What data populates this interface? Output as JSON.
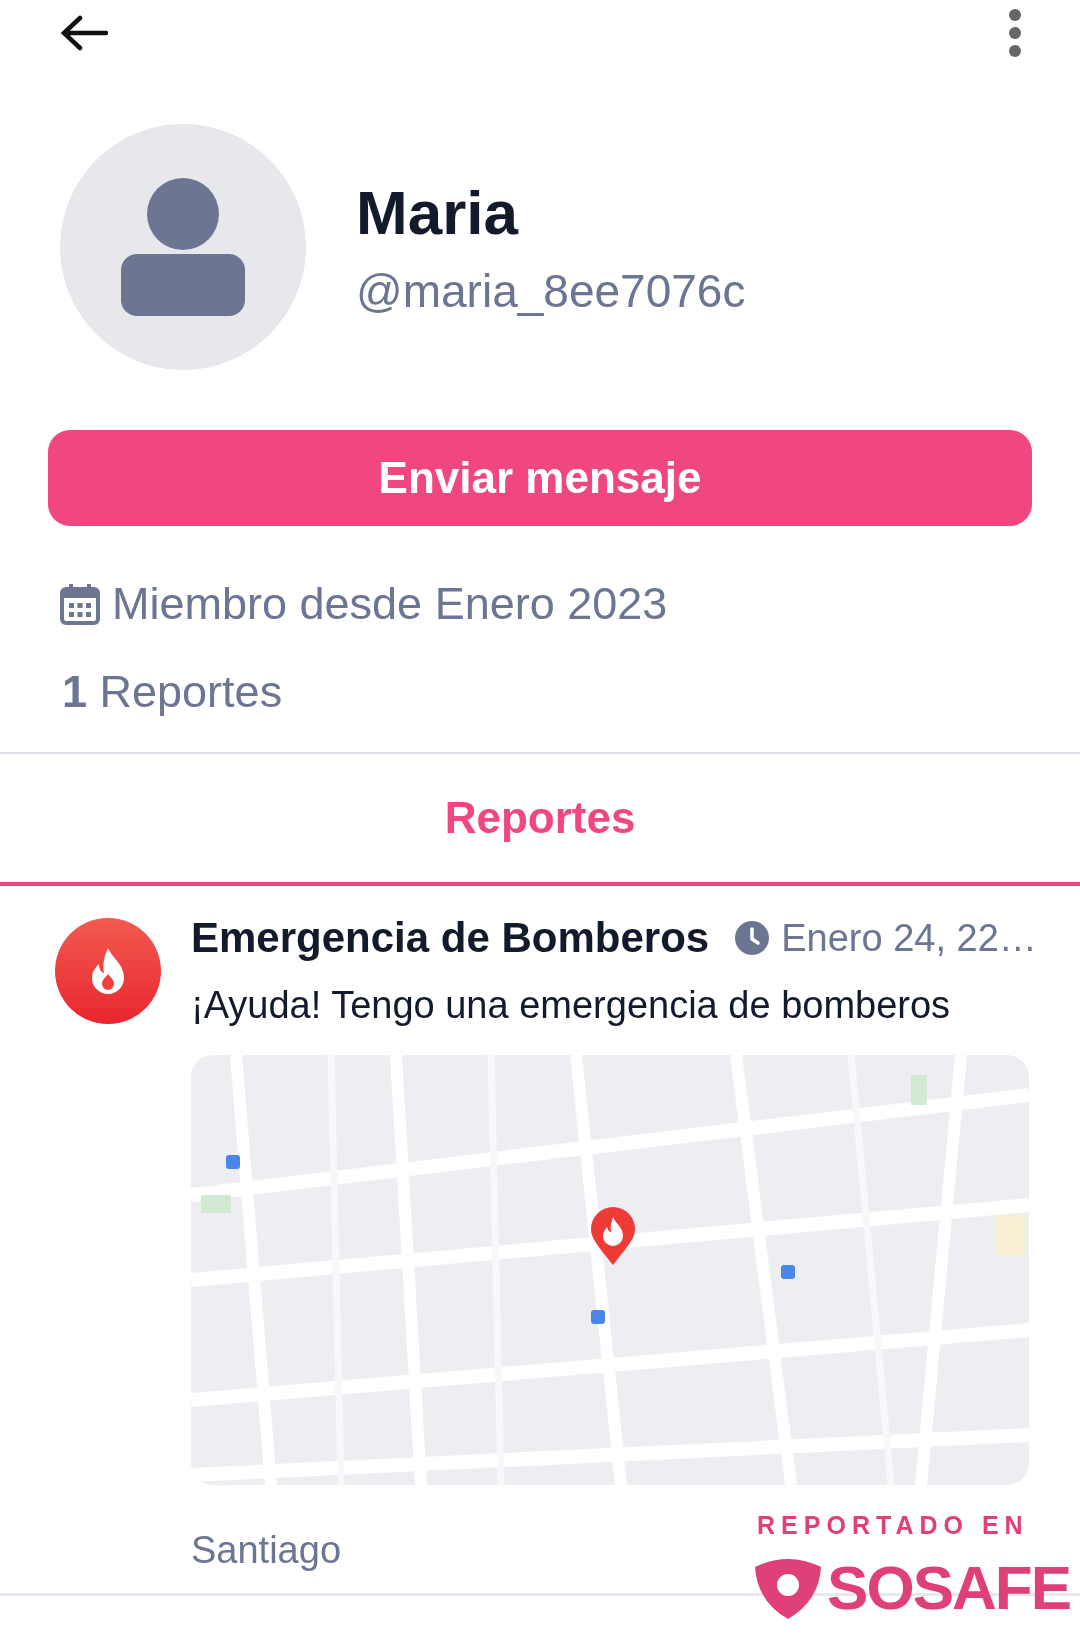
{
  "profile": {
    "name": "Maria",
    "handle": "@maria_8ee7076c"
  },
  "message_button": {
    "label": "Enviar mensaje"
  },
  "member_since": "Miembro desde Enero 2023",
  "report_count": "**1** Reportes",
  "tabs": [
    {
      "label": "Reportes",
      "selected": true
    }
  ],
  "reports": [
    {
      "kind": "fire",
      "title": "Emergencia de Bomberos",
      "time": "Enero 24, 22…",
      "text": "¡Ayuda! Tengo una emergencia de bomberos",
      "location": "Santiago"
    }
  ],
  "branding": {
    "caption": "REPORTADO EN",
    "logo": "SOSAFE"
  }
}
